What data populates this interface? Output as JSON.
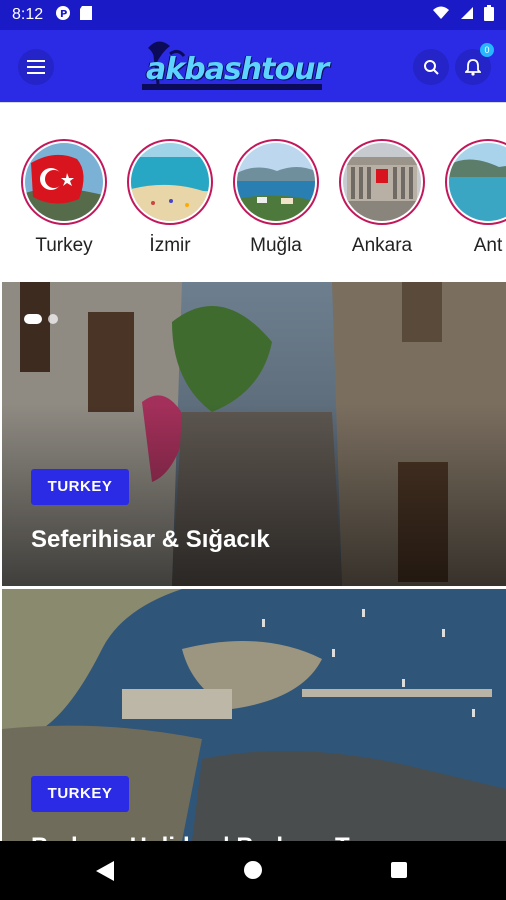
{
  "status": {
    "time": "8:12"
  },
  "header": {
    "logo_text": "akbashtour",
    "notifications_count": "0"
  },
  "stories": [
    {
      "label": "Turkey"
    },
    {
      "label": "İzmir"
    },
    {
      "label": "Muğla"
    },
    {
      "label": "Ankara"
    },
    {
      "label": "Ant"
    }
  ],
  "cards": [
    {
      "chip": "TURKEY",
      "title": "Seferihisar & Sığacık"
    },
    {
      "chip": "TURKEY",
      "title": "Bodrum Holiday | Bodrum Tours"
    }
  ],
  "colors": {
    "brand": "#2b2be6",
    "status_bar": "#1a1ac7",
    "ring": "#c2185b",
    "badge": "#26b7ff"
  }
}
